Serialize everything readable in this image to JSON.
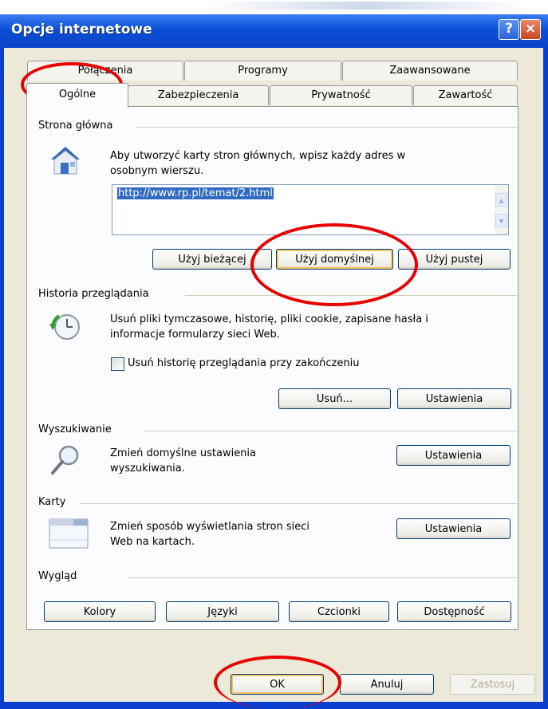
{
  "window": {
    "title": "Opcje internetowe",
    "help": "?",
    "close": "×"
  },
  "tabs": {
    "row1": [
      "Połączenia",
      "Programy",
      "Zaawansowane"
    ],
    "row2": [
      "Ogólne",
      "Zabezpieczenia",
      "Prywatność",
      "Zawartość"
    ]
  },
  "home": {
    "label": "Strona główna",
    "desc1": "Aby utworzyć karty stron głównych, wpisz każdy adres w",
    "desc2": "osobnym wierszu.",
    "url": "http://www.rp.pl/temat/2.html",
    "use_current": "Użyj bieżącej",
    "use_default": "Użyj domyślnej",
    "use_blank": "Użyj pustej"
  },
  "history": {
    "label": "Historia przeglądania",
    "desc1": "Usuń pliki tymczasowe, historię, pliki cookie, zapisane hasła i",
    "desc2": "informacje formularzy sieci Web.",
    "checkbox": "Usuń historię przeglądania przy zakończeniu",
    "delete": "Usuń...",
    "settings": "Ustawienia"
  },
  "search": {
    "label": "Wyszukiwanie",
    "desc1": "Zmień domyślne ustawienia",
    "desc2": "wyszukiwania.",
    "settings": "Ustawienia"
  },
  "tabs_section": {
    "label": "Karty",
    "desc1": "Zmień sposób wyświetlania stron sieci",
    "desc2": "Web na kartach.",
    "settings": "Ustawienia"
  },
  "appearance": {
    "label": "Wygląd",
    "colors": "Kolory",
    "languages": "Języki",
    "fonts": "Czcionki",
    "accessibility": "Dostępność"
  },
  "footer": {
    "ok": "OK",
    "cancel": "Anuluj",
    "apply": "Zastosuj"
  },
  "colors": {
    "title_bar": "#0b4fd8",
    "client": "#ece9d8",
    "highlight_circle": "#e80000"
  }
}
